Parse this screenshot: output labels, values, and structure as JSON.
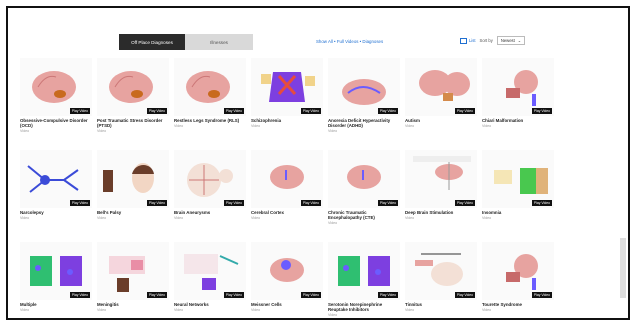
{
  "tabs": [
    {
      "label": "Off Place Diagnoses",
      "active": true
    },
    {
      "label": "Illnesses",
      "active": false
    }
  ],
  "header_link": "Show All  •  Full Videos  •  Diagnoses",
  "list_view_label": "List",
  "sort_label": "Sort by",
  "sort_value": "Newest",
  "videos": [
    {
      "title": "Obsessive-Compulsive Disorder (OCD)",
      "meta": "Video",
      "thumb": "brain"
    },
    {
      "title": "Post Traumatic Stress Disorder (PTSD)",
      "meta": "Video",
      "thumb": "brain"
    },
    {
      "title": "Restless Legs Syndrome (RLS)",
      "meta": "Video",
      "thumb": "brain"
    },
    {
      "title": "Schizophrenia",
      "meta": "Video",
      "thumb": "purple"
    },
    {
      "title": "Anorexia Deficit Hyperactivity Disorder (ADHD)",
      "meta": "Video",
      "thumb": "reward"
    },
    {
      "title": "Autism",
      "meta": "Video",
      "thumb": "brain2"
    },
    {
      "title": "Chiari Malformation",
      "meta": "Video",
      "thumb": "headred"
    },
    {
      "title": "Narcolepsy",
      "meta": "Video",
      "thumb": "neuron"
    },
    {
      "title": "Bell's Palsy",
      "meta": "Video",
      "thumb": "face"
    },
    {
      "title": "Brain Aneurysms",
      "meta": "Video",
      "thumb": "sketch"
    },
    {
      "title": "Cerebral Cortex",
      "meta": "Video",
      "thumb": "brainsmall"
    },
    {
      "title": "Chronic Traumatic Encephalopathy (CTE)",
      "meta": "Video",
      "thumb": "brainsmall"
    },
    {
      "title": "Deep Brain Stimulation",
      "meta": "Video",
      "thumb": "probe"
    },
    {
      "title": "Insomnia",
      "meta": "Video",
      "thumb": "green"
    },
    {
      "title": "Multiple",
      "meta": "Video",
      "thumb": "purplecells"
    },
    {
      "title": "Meningitis",
      "meta": "Video",
      "thumb": "pink"
    },
    {
      "title": "Neural Networks",
      "meta": "Video",
      "thumb": "sketch2"
    },
    {
      "title": "Meissner Cells",
      "meta": "Video",
      "thumb": "brainpurple"
    },
    {
      "title": "Serotonin Norepinephrine Reuptake Inhibitors",
      "meta": "Video",
      "thumb": "purplecells"
    },
    {
      "title": "Tinnitus",
      "meta": "Video",
      "thumb": "tinnitus"
    },
    {
      "title": "Tourette Syndrome",
      "meta": "Video",
      "thumb": "headred"
    }
  ],
  "play_badge": "Play Video"
}
